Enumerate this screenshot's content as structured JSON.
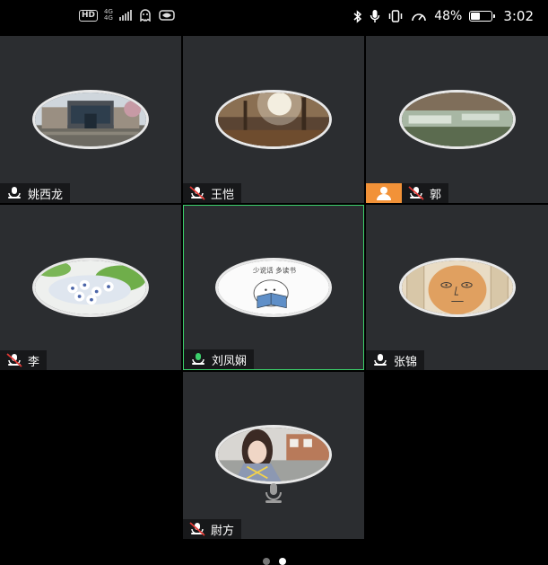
{
  "status_bar": {
    "network_hd": "HD",
    "network_gen_top": "4G",
    "network_gen_bottom": "4G",
    "battery_percent_text": "48%",
    "battery_level": 0.48,
    "time": "3:02"
  },
  "participants": [
    {
      "name": "姚西龙",
      "mic": "muted",
      "avatar_icon": "building-photo-avatar"
    },
    {
      "name": "王恺",
      "mic": "muted-red",
      "avatar_icon": "forest-sunlight-avatar"
    },
    {
      "name": "郭",
      "mic": "muted-red",
      "avatar_icon": "waterfall-stream-avatar",
      "host_badge": true
    },
    {
      "name": "李",
      "mic": "muted-red",
      "avatar_icon": "white-flowers-avatar"
    },
    {
      "name": "刘凤娴",
      "mic": "active-green",
      "avatar_icon": "cartoon-reading-avatar",
      "avatar_caption": "少说话 多读书",
      "speaking": true
    },
    {
      "name": "张锦",
      "mic": "muted",
      "avatar_icon": "cartoon-face-avatar"
    },
    {
      "name": "尉方",
      "mic": "muted-red",
      "avatar_icon": "girl-selfie-avatar"
    }
  ],
  "pagination": {
    "pages": 2,
    "current": 2
  },
  "colors": {
    "tile_bg": "#2b2d30",
    "active_border": "#3bd06b",
    "host_badge": "#f29238",
    "muted_red": "#e53935"
  }
}
